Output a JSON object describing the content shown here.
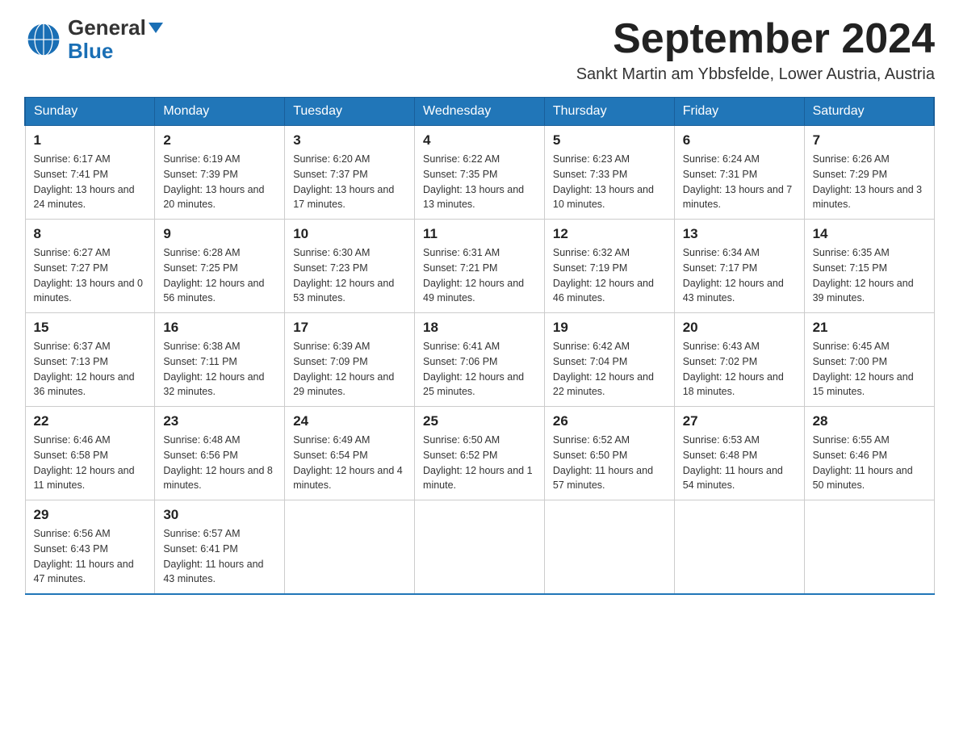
{
  "header": {
    "month_year": "September 2024",
    "location": "Sankt Martin am Ybbsfelde, Lower Austria, Austria",
    "logo_general": "General",
    "logo_blue": "Blue"
  },
  "weekdays": [
    "Sunday",
    "Monday",
    "Tuesday",
    "Wednesday",
    "Thursday",
    "Friday",
    "Saturday"
  ],
  "weeks": [
    [
      {
        "day": "1",
        "sunrise": "6:17 AM",
        "sunset": "7:41 PM",
        "daylight": "13 hours and 24 minutes."
      },
      {
        "day": "2",
        "sunrise": "6:19 AM",
        "sunset": "7:39 PM",
        "daylight": "13 hours and 20 minutes."
      },
      {
        "day": "3",
        "sunrise": "6:20 AM",
        "sunset": "7:37 PM",
        "daylight": "13 hours and 17 minutes."
      },
      {
        "day": "4",
        "sunrise": "6:22 AM",
        "sunset": "7:35 PM",
        "daylight": "13 hours and 13 minutes."
      },
      {
        "day": "5",
        "sunrise": "6:23 AM",
        "sunset": "7:33 PM",
        "daylight": "13 hours and 10 minutes."
      },
      {
        "day": "6",
        "sunrise": "6:24 AM",
        "sunset": "7:31 PM",
        "daylight": "13 hours and 7 minutes."
      },
      {
        "day": "7",
        "sunrise": "6:26 AM",
        "sunset": "7:29 PM",
        "daylight": "13 hours and 3 minutes."
      }
    ],
    [
      {
        "day": "8",
        "sunrise": "6:27 AM",
        "sunset": "7:27 PM",
        "daylight": "13 hours and 0 minutes."
      },
      {
        "day": "9",
        "sunrise": "6:28 AM",
        "sunset": "7:25 PM",
        "daylight": "12 hours and 56 minutes."
      },
      {
        "day": "10",
        "sunrise": "6:30 AM",
        "sunset": "7:23 PM",
        "daylight": "12 hours and 53 minutes."
      },
      {
        "day": "11",
        "sunrise": "6:31 AM",
        "sunset": "7:21 PM",
        "daylight": "12 hours and 49 minutes."
      },
      {
        "day": "12",
        "sunrise": "6:32 AM",
        "sunset": "7:19 PM",
        "daylight": "12 hours and 46 minutes."
      },
      {
        "day": "13",
        "sunrise": "6:34 AM",
        "sunset": "7:17 PM",
        "daylight": "12 hours and 43 minutes."
      },
      {
        "day": "14",
        "sunrise": "6:35 AM",
        "sunset": "7:15 PM",
        "daylight": "12 hours and 39 minutes."
      }
    ],
    [
      {
        "day": "15",
        "sunrise": "6:37 AM",
        "sunset": "7:13 PM",
        "daylight": "12 hours and 36 minutes."
      },
      {
        "day": "16",
        "sunrise": "6:38 AM",
        "sunset": "7:11 PM",
        "daylight": "12 hours and 32 minutes."
      },
      {
        "day": "17",
        "sunrise": "6:39 AM",
        "sunset": "7:09 PM",
        "daylight": "12 hours and 29 minutes."
      },
      {
        "day": "18",
        "sunrise": "6:41 AM",
        "sunset": "7:06 PM",
        "daylight": "12 hours and 25 minutes."
      },
      {
        "day": "19",
        "sunrise": "6:42 AM",
        "sunset": "7:04 PM",
        "daylight": "12 hours and 22 minutes."
      },
      {
        "day": "20",
        "sunrise": "6:43 AM",
        "sunset": "7:02 PM",
        "daylight": "12 hours and 18 minutes."
      },
      {
        "day": "21",
        "sunrise": "6:45 AM",
        "sunset": "7:00 PM",
        "daylight": "12 hours and 15 minutes."
      }
    ],
    [
      {
        "day": "22",
        "sunrise": "6:46 AM",
        "sunset": "6:58 PM",
        "daylight": "12 hours and 11 minutes."
      },
      {
        "day": "23",
        "sunrise": "6:48 AM",
        "sunset": "6:56 PM",
        "daylight": "12 hours and 8 minutes."
      },
      {
        "day": "24",
        "sunrise": "6:49 AM",
        "sunset": "6:54 PM",
        "daylight": "12 hours and 4 minutes."
      },
      {
        "day": "25",
        "sunrise": "6:50 AM",
        "sunset": "6:52 PM",
        "daylight": "12 hours and 1 minute."
      },
      {
        "day": "26",
        "sunrise": "6:52 AM",
        "sunset": "6:50 PM",
        "daylight": "11 hours and 57 minutes."
      },
      {
        "day": "27",
        "sunrise": "6:53 AM",
        "sunset": "6:48 PM",
        "daylight": "11 hours and 54 minutes."
      },
      {
        "day": "28",
        "sunrise": "6:55 AM",
        "sunset": "6:46 PM",
        "daylight": "11 hours and 50 minutes."
      }
    ],
    [
      {
        "day": "29",
        "sunrise": "6:56 AM",
        "sunset": "6:43 PM",
        "daylight": "11 hours and 47 minutes."
      },
      {
        "day": "30",
        "sunrise": "6:57 AM",
        "sunset": "6:41 PM",
        "daylight": "11 hours and 43 minutes."
      },
      {
        "day": "",
        "sunrise": "",
        "sunset": "",
        "daylight": ""
      },
      {
        "day": "",
        "sunrise": "",
        "sunset": "",
        "daylight": ""
      },
      {
        "day": "",
        "sunrise": "",
        "sunset": "",
        "daylight": ""
      },
      {
        "day": "",
        "sunrise": "",
        "sunset": "",
        "daylight": ""
      },
      {
        "day": "",
        "sunrise": "",
        "sunset": "",
        "daylight": ""
      }
    ]
  ]
}
